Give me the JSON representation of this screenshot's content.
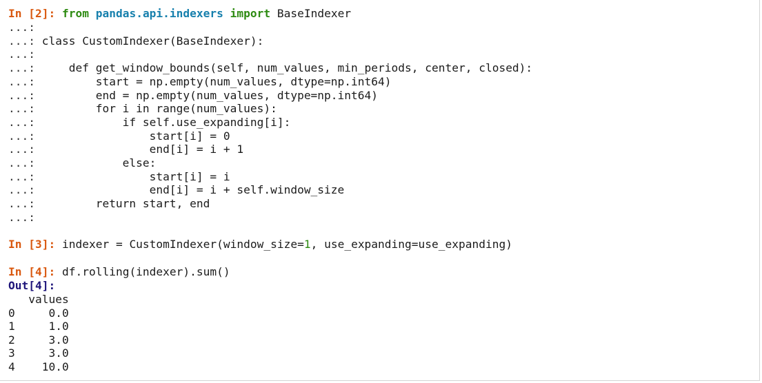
{
  "session": {
    "cells": [
      {
        "prompt": "In [2]:",
        "lines": [
          {
            "kw1": "from",
            "module": "pandas.api.indexers",
            "kw2": "import",
            "name": "BaseIndexer"
          }
        ]
      }
    ],
    "continuation": "...:",
    "cell2_lines": [
      "",
      "class CustomIndexer(BaseIndexer):",
      "",
      "    def get_window_bounds(self, num_values, min_periods, center, closed):",
      "        start = np.empty(num_values, dtype=np.int64)",
      "        end = np.empty(num_values, dtype=np.int64)",
      "        for i in range(num_values):",
      "            if self.use_expanding[i]:",
      "                start[i] = 0",
      "                end[i] = i + 1",
      "            else:",
      "                start[i] = i",
      "                end[i] = i + self.window_size",
      "        return start, end",
      ""
    ],
    "cell3": {
      "prompt": "In [3]:",
      "before": "indexer = CustomIndexer(window_size=",
      "number": "1",
      "after": ", use_expanding=use_expanding)"
    },
    "cell4": {
      "prompt": "In [4]:",
      "code": "df.rolling(indexer).sum()",
      "out_prompt": "Out[4]:",
      "output_lines": [
        "   values",
        "0     0.0",
        "1     1.0",
        "2     3.0",
        "3     3.0",
        "4    10.0"
      ]
    }
  },
  "colors": {
    "in_prompt": "#d9580f",
    "out_prompt": "#1e157a",
    "keyword": "#2e8b12",
    "module": "#1780ad"
  }
}
